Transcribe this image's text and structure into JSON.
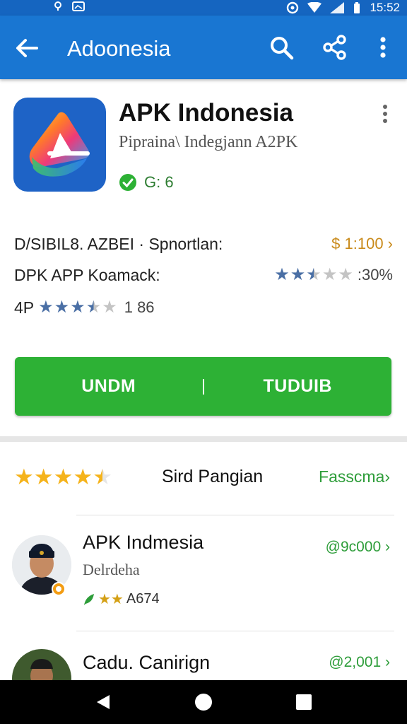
{
  "status": {
    "time": "15:52"
  },
  "app_bar": {
    "title": "Adoonesia"
  },
  "app": {
    "name": "APK Indonesia",
    "subtitle": "Pipraina\\ Indegjann A2PK",
    "verified_label": "G: 6"
  },
  "info": {
    "row1_label": "D/SIBIL8. AZBEI · Spnortlan:",
    "row1_value": "$ 1:100 ›",
    "row2_label": "DPK APP Koamack:",
    "row2_rating": 2.5,
    "row2_value": ":30%",
    "row3_label": "4P",
    "row3_rating": 3.5,
    "row3_value": "1 86"
  },
  "action": {
    "left_label": "UNDM",
    "right_label": "TUDUIB"
  },
  "reviews_header": {
    "rating": 4.5,
    "sort_label": "Sird Pangian",
    "link": "Fasscma›"
  },
  "reviews": [
    {
      "name": "APK Indmesia",
      "subtitle": "Delrdeha",
      "meta": "A674",
      "amount": "@9c000 ›"
    },
    {
      "name": "Cadu. Canirign",
      "amount": "@2,001 ›"
    }
  ],
  "colors": {
    "primary": "#1976d2",
    "status": "#1565c0",
    "action": "#2db135",
    "link": "#2e9d3a",
    "star_rating": "#4a6fa5",
    "star_gold": "#f5b31b"
  }
}
